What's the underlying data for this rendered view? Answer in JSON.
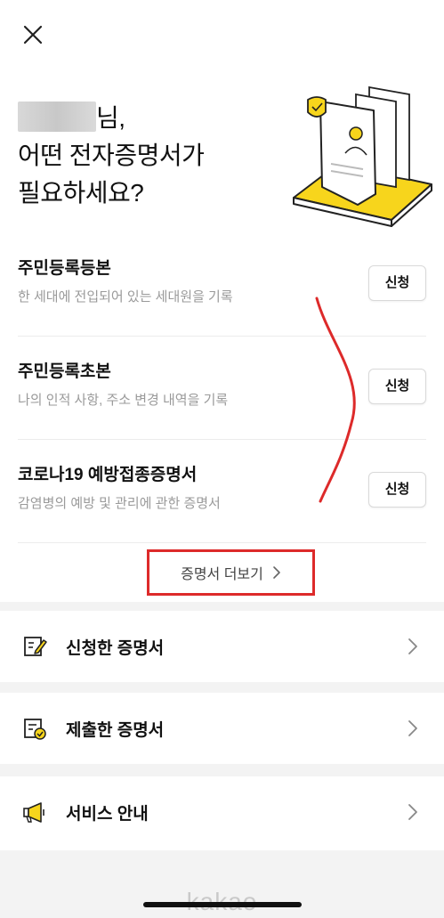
{
  "header": {
    "close_icon": "close-icon"
  },
  "greeting": {
    "name_suffix": "님,",
    "line2_highlight": "어떤 전자증명서",
    "line2_rest": "가",
    "line3": "필요하세요?"
  },
  "colors": {
    "accent_yellow": "#f7d51c",
    "highlight_red": "#dd2a2a",
    "section_gap": "#f3f3f3"
  },
  "certificates": [
    {
      "title": "주민등록등본",
      "desc": "한 세대에 전입되어 있는 세대원을 기록",
      "button": "신청"
    },
    {
      "title": "주민등록초본",
      "desc": "나의 인적 사항, 주소 변경 내역을 기록",
      "button": "신청"
    },
    {
      "title": "코로나19 예방접종증명서",
      "desc": "감염병의 예방 및 관리에 관한 증명서",
      "button": "신청"
    }
  ],
  "more": {
    "label": "증명서 더보기",
    "icon": "chevron-right-icon"
  },
  "menu": [
    {
      "label": "신청한 증명서",
      "icon": "document-edit-icon"
    },
    {
      "label": "제출한 증명서",
      "icon": "document-check-icon"
    },
    {
      "label": "서비스 안내",
      "icon": "megaphone-icon"
    }
  ],
  "footer": {
    "logo": "kakao"
  }
}
